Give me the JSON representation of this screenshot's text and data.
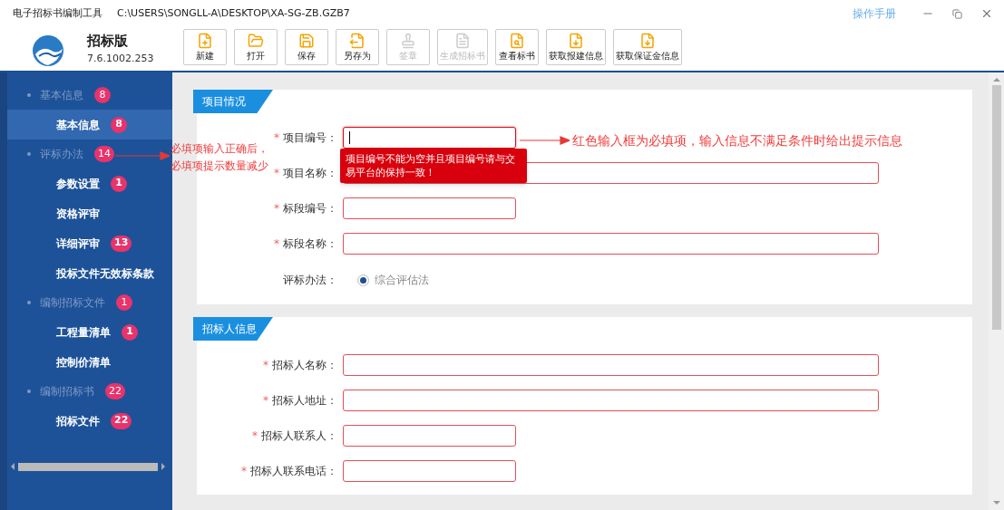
{
  "window": {
    "app_name": "电子招标书编制工具",
    "file_path": "C:\\USERS\\SONGLL-A\\DESKTOP\\XA-SG-ZB.GZB7",
    "help_link": "操作手册"
  },
  "product": {
    "edition": "招标版",
    "version": "7.6.1002.253"
  },
  "toolbar": [
    {
      "kind": "new",
      "label": "新建",
      "disabled": false
    },
    {
      "kind": "open",
      "label": "打开",
      "disabled": false
    },
    {
      "kind": "save",
      "label": "保存",
      "disabled": false
    },
    {
      "kind": "saveas",
      "label": "另存为",
      "disabled": false
    },
    {
      "kind": "stamp",
      "label": "签章",
      "disabled": true
    },
    {
      "kind": "generate",
      "label": "生成招标书",
      "disabled": true
    },
    {
      "kind": "view",
      "label": "查看标书",
      "disabled": false
    },
    {
      "kind": "fetch",
      "label": "获取报建信息",
      "disabled": false
    },
    {
      "kind": "fetch",
      "label": "获取保证金信息",
      "disabled": false
    }
  ],
  "sidebar": {
    "items": [
      {
        "label": "基本信息",
        "badge": "8",
        "children": [
          {
            "label": "基本信息",
            "badge": "8",
            "selected": true
          }
        ]
      },
      {
        "label": "评标办法",
        "badge": "14",
        "children": [
          {
            "label": "参数设置",
            "badge": "1",
            "selected": false
          },
          {
            "label": "资格评审",
            "selected": false
          },
          {
            "label": "详细评审",
            "badge": "13",
            "selected": false
          },
          {
            "label": "投标文件无效标条款",
            "selected": false
          }
        ]
      },
      {
        "label": "编制招标文件",
        "badge": "1",
        "children": [
          {
            "label": "工程量清单",
            "badge": "1",
            "selected": false
          },
          {
            "label": "控制价清单",
            "selected": false
          }
        ]
      },
      {
        "label": "编制招标书",
        "badge": "22",
        "children": [
          {
            "label": "招标文件",
            "badge": "22",
            "selected": false
          }
        ]
      }
    ]
  },
  "sections": [
    {
      "title": "项目情况",
      "fields": [
        {
          "kind": "short",
          "label": "项目编号：",
          "marker": "*",
          "focused": true,
          "error": "项目编号不能为空并且项目编号请与交易平台的保持一致！"
        },
        {
          "kind": "long",
          "label": "项目名称：",
          "marker": "*",
          "focused": false
        },
        {
          "kind": "short",
          "label": "标段编号：",
          "marker": "*",
          "focused": false
        },
        {
          "kind": "long",
          "label": "标段名称：",
          "marker": "*",
          "focused": false
        },
        {
          "kind": "radio",
          "label": "评标办法：",
          "options": [
            {
              "label": "综合评估法",
              "selected": true
            }
          ]
        }
      ]
    },
    {
      "title": "招标人信息",
      "fields": [
        {
          "kind": "long",
          "label": "招标人名称：",
          "marker": "*",
          "focused": false
        },
        {
          "kind": "long",
          "label": "招标人地址：",
          "marker": "*",
          "focused": false
        },
        {
          "kind": "short",
          "label": "招标人联系人：",
          "marker": "*",
          "focused": false
        },
        {
          "kind": "short",
          "label": "招标人联系电话：",
          "marker": "*",
          "focused": false
        }
      ]
    }
  ],
  "annotations": [
    {
      "kind": "sidebar",
      "lines": [
        "必填项输入正确后，",
        "必填项提示数量减少"
      ]
    },
    {
      "kind": "field",
      "lines": [
        "红色输入框为必填项，输入信息不满足条件时给出提示信息"
      ]
    }
  ]
}
